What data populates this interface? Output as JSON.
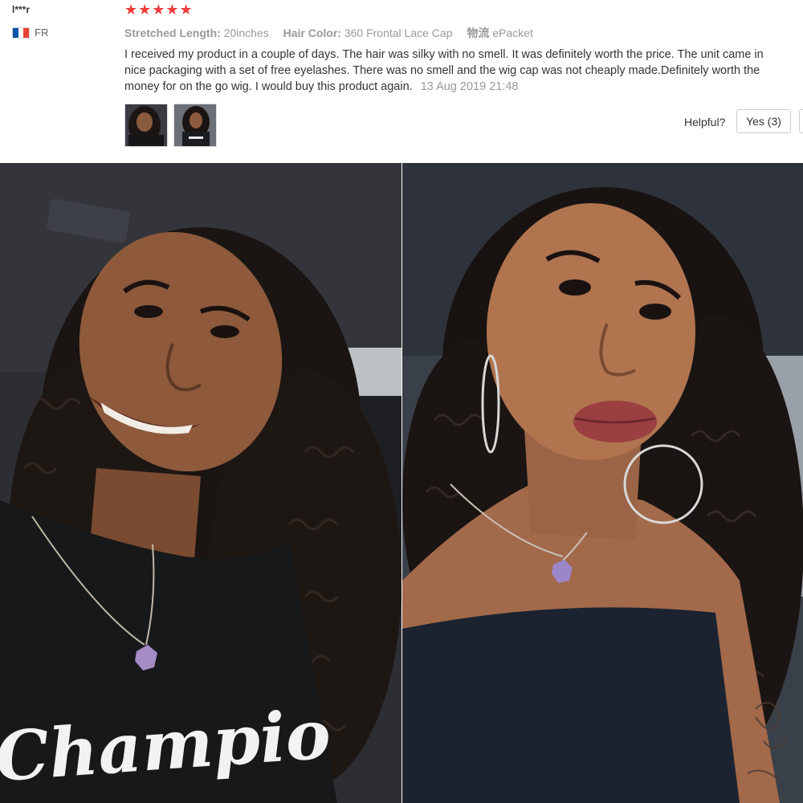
{
  "review": {
    "user": "l***r",
    "country": "FR",
    "rating_stars": "★★★★★",
    "rating": 5,
    "attributes": [
      {
        "key": "Stretched Length:",
        "value": "20inches"
      },
      {
        "key": "Hair Color:",
        "value": "360 Frontal Lace Cap"
      },
      {
        "key": "物流",
        "value": "ePacket"
      }
    ],
    "text": "I received my product in a couple of days. The hair was silky with no smell. It was definitely worth the price. The unit came in nice packaging with a set of free eyelashes. There was no smell and the wig cap was not cheaply made.Definitely worth the money for on the go wig. I would buy this product again.",
    "date": "13 Aug 2019 21:48",
    "helpful_label": "Helpful?",
    "yes_label": "Yes (3)"
  },
  "photos": {
    "left_shirt_text": "Champio"
  },
  "colors": {
    "stars": "#ef3b3b",
    "muted_text": "#999999",
    "body_text": "#333333",
    "flag_blue": "#0055a4",
    "flag_red": "#ef4135"
  }
}
